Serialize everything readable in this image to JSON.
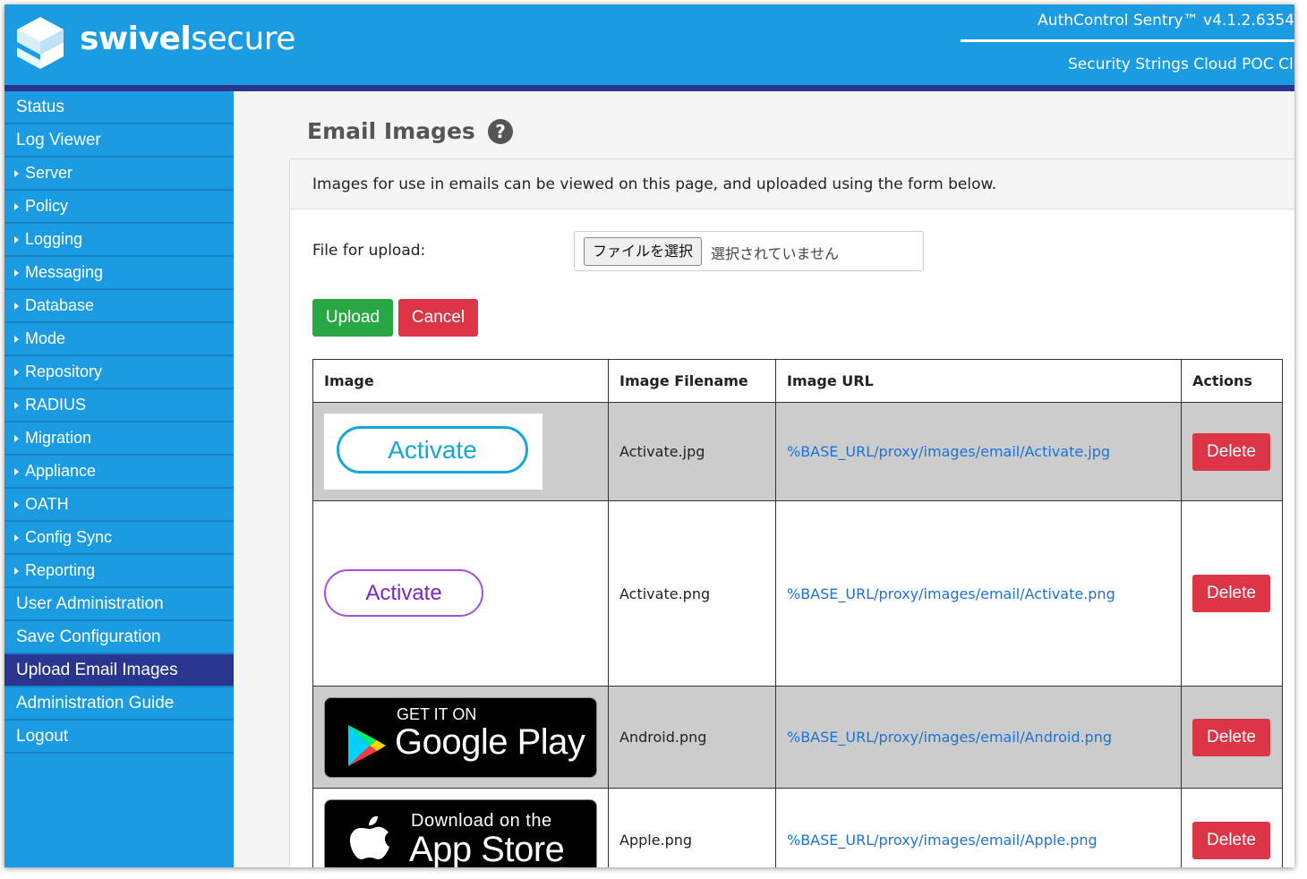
{
  "brand": {
    "logo_text_bold": "swivel",
    "logo_text_light": "secure",
    "product_version": "AuthControl Sentry™ v4.1.2.6354",
    "customer_name": "Security Strings Cloud POC Cl",
    "primary_color": "#1a9be2",
    "accent_color": "#2a3590"
  },
  "sidebar": {
    "items": [
      {
        "label": "Status",
        "type": "top"
      },
      {
        "label": "Log Viewer",
        "type": "top"
      },
      {
        "label": "Server",
        "type": "sub"
      },
      {
        "label": "Policy",
        "type": "sub"
      },
      {
        "label": "Logging",
        "type": "sub"
      },
      {
        "label": "Messaging",
        "type": "sub"
      },
      {
        "label": "Database",
        "type": "sub"
      },
      {
        "label": "Mode",
        "type": "sub"
      },
      {
        "label": "Repository",
        "type": "sub"
      },
      {
        "label": "RADIUS",
        "type": "sub"
      },
      {
        "label": "Migration",
        "type": "sub"
      },
      {
        "label": "Appliance",
        "type": "sub"
      },
      {
        "label": "OATH",
        "type": "sub"
      },
      {
        "label": "Config Sync",
        "type": "sub"
      },
      {
        "label": "Reporting",
        "type": "sub"
      },
      {
        "label": "User Administration",
        "type": "top"
      },
      {
        "label": "Save Configuration",
        "type": "top"
      },
      {
        "label": "Upload Email Images",
        "type": "top",
        "active": true
      },
      {
        "label": "Administration Guide",
        "type": "top"
      },
      {
        "label": "Logout",
        "type": "top"
      }
    ]
  },
  "main": {
    "title": "Email Images",
    "help_icon": "question-circle-icon",
    "intro": "Images for use in emails can be viewed on this page, and uploaded using the form below.",
    "upload_label": "File for upload:",
    "file_button": "ファイルを選択",
    "file_status": "選択されていません",
    "upload_button": "Upload",
    "cancel_button": "Cancel"
  },
  "table": {
    "headers": [
      "Image",
      "Image Filename",
      "Image URL",
      "Actions"
    ],
    "rows": [
      {
        "image_text": "Activate",
        "filename": "Activate.jpg",
        "url": "%BASE_URL/proxy/images/email/Activate.jpg",
        "action": "Delete"
      },
      {
        "image_text": "Activate",
        "filename": "Activate.png",
        "url": "%BASE_URL/proxy/images/email/Activate.png",
        "action": "Delete"
      },
      {
        "image_small": "GET IT ON",
        "image_big": "Google Play",
        "filename": "Android.png",
        "url": "%BASE_URL/proxy/images/email/Android.png",
        "action": "Delete"
      },
      {
        "image_small": "Download on the",
        "image_big": "App Store",
        "filename": "Apple.png",
        "url": "%BASE_URL/proxy/images/email/Apple.png",
        "action": "Delete"
      }
    ]
  }
}
